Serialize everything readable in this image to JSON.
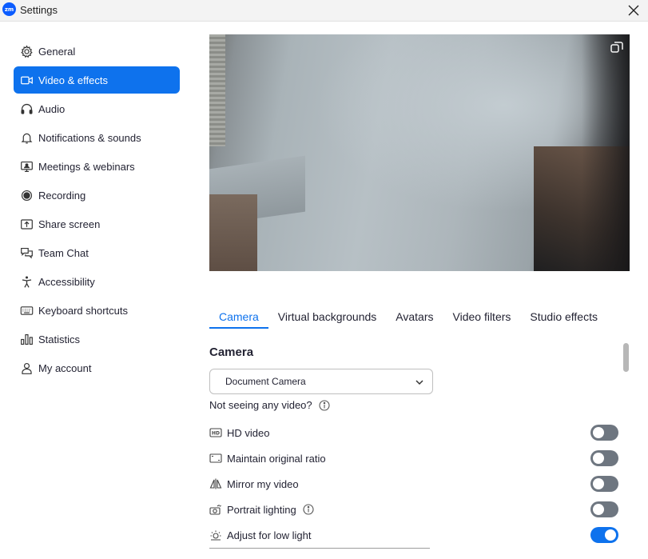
{
  "window": {
    "title": "Settings",
    "logo_text": "zm"
  },
  "sidebar": {
    "items": [
      {
        "label": "General",
        "icon": "gear-icon",
        "active": false
      },
      {
        "label": "Video & effects",
        "icon": "video-icon",
        "active": true
      },
      {
        "label": "Audio",
        "icon": "headphones-icon",
        "active": false
      },
      {
        "label": "Notifications & sounds",
        "icon": "bell-icon",
        "active": false
      },
      {
        "label": "Meetings & webinars",
        "icon": "monitor-icon",
        "active": false
      },
      {
        "label": "Recording",
        "icon": "record-icon",
        "active": false
      },
      {
        "label": "Share screen",
        "icon": "share-screen-icon",
        "active": false
      },
      {
        "label": "Team Chat",
        "icon": "chat-icon",
        "active": false
      },
      {
        "label": "Accessibility",
        "icon": "accessibility-icon",
        "active": false
      },
      {
        "label": "Keyboard shortcuts",
        "icon": "keyboard-icon",
        "active": false
      },
      {
        "label": "Statistics",
        "icon": "statistics-icon",
        "active": false
      },
      {
        "label": "My account",
        "icon": "user-icon",
        "active": false
      }
    ]
  },
  "tabs": [
    {
      "label": "Camera",
      "active": true
    },
    {
      "label": "Virtual backgrounds",
      "active": false
    },
    {
      "label": "Avatars",
      "active": false
    },
    {
      "label": "Video filters",
      "active": false
    },
    {
      "label": "Studio effects",
      "active": false
    }
  ],
  "camera": {
    "section_title": "Camera",
    "selected_camera": "Document Camera",
    "help_text": "Not seeing any video?",
    "options": [
      {
        "label": "HD video",
        "icon": "hd-icon",
        "on": false
      },
      {
        "label": "Maintain original ratio",
        "icon": "ratio-icon",
        "on": false
      },
      {
        "label": "Mirror my video",
        "icon": "mirror-icon",
        "on": false
      },
      {
        "label": "Portrait lighting",
        "icon": "portrait-lighting-icon",
        "on": false,
        "info": true
      },
      {
        "label": "Adjust for low light",
        "icon": "low-light-icon",
        "on": true
      }
    ]
  },
  "colors": {
    "accent": "#0e72ed",
    "toggle_off": "#6e7680",
    "logo": "#0b5cff"
  }
}
